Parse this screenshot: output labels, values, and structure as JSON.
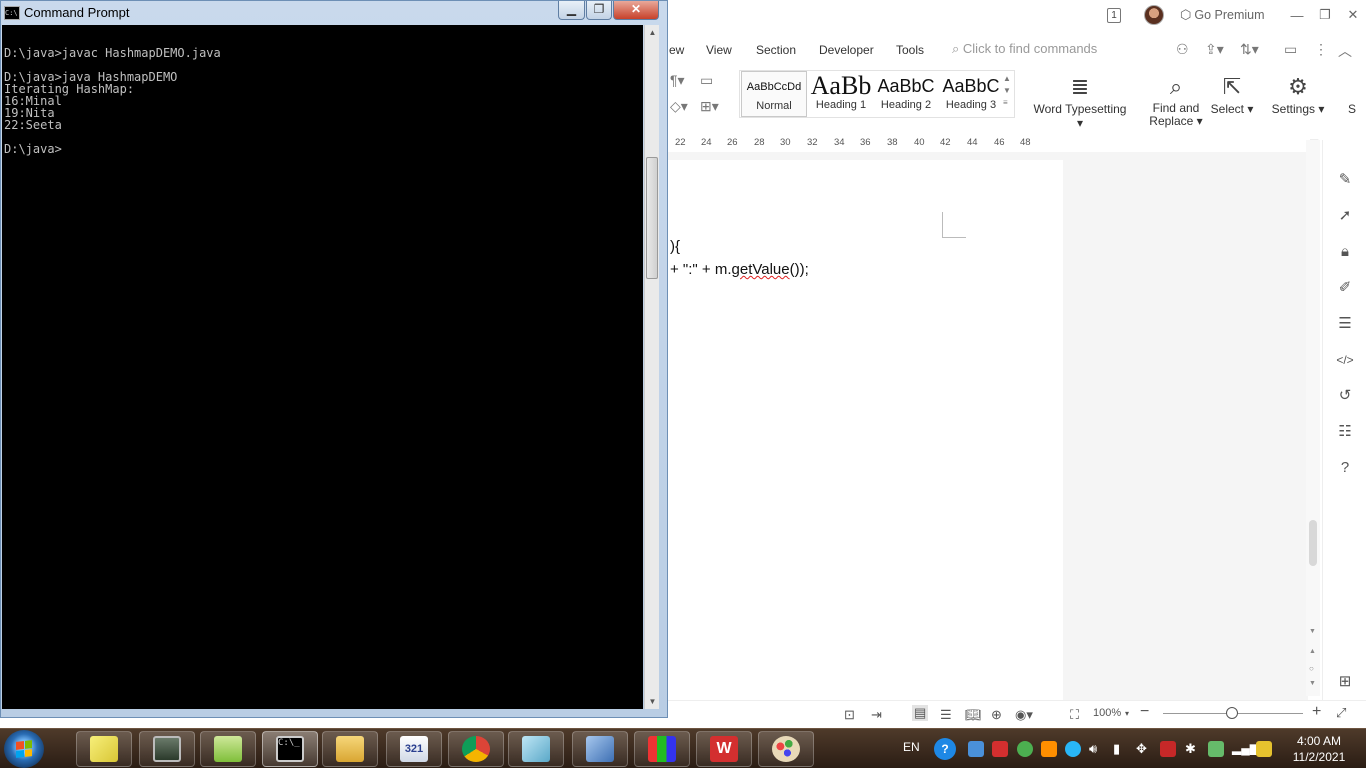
{
  "cmd_window": {
    "title": "Command Prompt",
    "console_lines": [
      "",
      "D:\\java>javac HashmapDEMO.java",
      "",
      "D:\\java>java HashmapDEMO",
      "Iterating HashMap:",
      "16:Minal",
      "19:Nita",
      "22:Seeta",
      "",
      "D:\\java>"
    ]
  },
  "wps": {
    "badge": "1",
    "go_premium": "Go Premium",
    "menu": [
      "ew",
      "View",
      "Section",
      "Developer",
      "Tools"
    ],
    "search_placeholder": "Click to find commands",
    "styles": [
      {
        "sample": "AaBbCcDd",
        "label": "Normal"
      },
      {
        "sample": "AaBb",
        "label": "Heading 1"
      },
      {
        "sample": "AaBbC",
        "label": "Heading 2"
      },
      {
        "sample": "AaBbC",
        "label": "Heading 3"
      }
    ],
    "ribbon_buttons": {
      "word_typesetting": "Word Typesetting",
      "find_replace_1": "Find and",
      "find_replace_2": "Replace",
      "select": "Select",
      "settings": "Settings",
      "cut_off": "S"
    },
    "ruler_ticks": [
      "22",
      "24",
      "26",
      "28",
      "30",
      "32",
      "34",
      "36",
      "38",
      "40",
      "42",
      "44",
      "46",
      "48"
    ],
    "doc_lines": {
      "line1": "){",
      "line2_a": "+ \":\" + m.",
      "line2_b": "getValue",
      "line2_c": "());"
    },
    "status": {
      "zoom": "100%"
    }
  },
  "taskbar": {
    "lang": "EN",
    "time": "4:00 AM",
    "date": "11/2/2021",
    "apps": [
      {
        "icon": "start-orb"
      },
      {
        "icon": "sticky-notes-icon"
      },
      {
        "icon": "system-monitor-icon"
      },
      {
        "icon": "notepad-plus-plus-icon"
      },
      {
        "icon": "command-prompt-icon"
      },
      {
        "icon": "file-explorer-icon"
      },
      {
        "icon": "media-player-321-icon"
      },
      {
        "icon": "chrome-icon"
      },
      {
        "icon": "notes-icon"
      },
      {
        "icon": "virtualbox-icon"
      },
      {
        "icon": "blocks-app-icon"
      },
      {
        "icon": "wps-office-icon"
      },
      {
        "icon": "paint-icon"
      }
    ],
    "colors": {
      "taskbar": "#2b1d14",
      "console_bg": "#000000",
      "console_text": "#c0c0c0"
    }
  }
}
